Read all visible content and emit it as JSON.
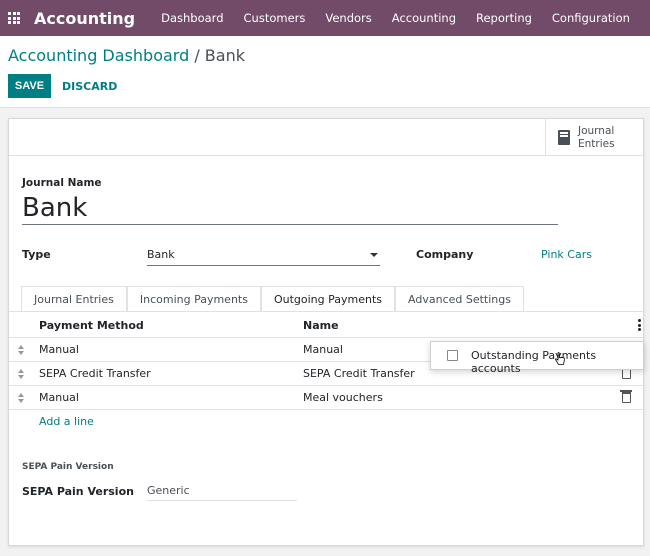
{
  "app": {
    "title": "Accounting"
  },
  "menu": [
    "Dashboard",
    "Customers",
    "Vendors",
    "Accounting",
    "Reporting",
    "Configuration"
  ],
  "breadcrumb": {
    "parent": "Accounting Dashboard",
    "separator": " / ",
    "current": "Bank"
  },
  "actions": {
    "save": "SAVE",
    "discard": "DISCARD"
  },
  "smart_button": {
    "line1": "Journal",
    "line2": "Entries",
    "icon": "book-icon"
  },
  "form": {
    "journal_name_label": "Journal Name",
    "journal_name": "Bank",
    "type_label": "Type",
    "type_value": "Bank",
    "company_label": "Company",
    "company_value": "Pink Cars"
  },
  "tabs": [
    "Journal Entries",
    "Incoming Payments",
    "Outgoing Payments",
    "Advanced Settings"
  ],
  "active_tab": "Outgoing Payments",
  "table": {
    "headers": [
      "Payment Method",
      "Name"
    ],
    "rows": [
      {
        "method": "Manual",
        "name": "Manual"
      },
      {
        "method": "SEPA Credit Transfer",
        "name": "SEPA Credit Transfer"
      },
      {
        "method": "Manual",
        "name": "Meal vouchers"
      }
    ],
    "add_line": "Add a line"
  },
  "sepa": {
    "section": "SEPA Pain Version",
    "label": "SEPA Pain Version",
    "value": "Generic"
  },
  "column_dropdown": {
    "option": "Outstanding Payments accounts",
    "checked": false
  },
  "colors": {
    "brand": "#714B67",
    "accent": "#017e84"
  }
}
